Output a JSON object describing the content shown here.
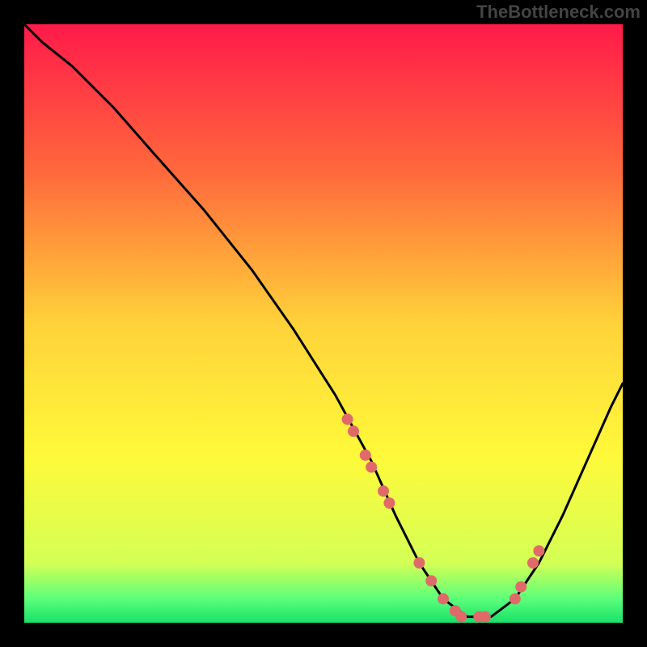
{
  "watermark": "TheBottleneck.com",
  "colors": {
    "curve": "#000000",
    "marker_fill": "#e06a6a",
    "marker_stroke": "#aa4040",
    "gradient_stops": [
      "#ff1a4a",
      "#ff6a3c",
      "#ffd23a",
      "#fff93a",
      "#d4ff55",
      "#5cff7a",
      "#18e06a"
    ]
  },
  "chart_data": {
    "type": "line",
    "title": "",
    "xlabel": "",
    "ylabel": "",
    "xlim": [
      0,
      100
    ],
    "ylim": [
      0,
      100
    ],
    "curve": {
      "x": [
        0,
        3,
        8,
        15,
        22,
        30,
        38,
        45,
        52,
        58,
        62,
        66,
        70,
        74,
        78,
        82,
        86,
        90,
        94,
        98,
        100
      ],
      "y": [
        100,
        97,
        93,
        86,
        78,
        69,
        59,
        49,
        38,
        27,
        18,
        10,
        4,
        1,
        1,
        4,
        10,
        18,
        27,
        36,
        40
      ]
    },
    "markers": {
      "comment": "scatter points lying on the curve",
      "x": [
        54,
        55,
        57,
        58,
        60,
        61,
        66,
        68,
        70,
        72,
        73,
        76,
        77,
        82,
        83,
        85,
        86
      ],
      "y": [
        34,
        32,
        28,
        26,
        22,
        20,
        10,
        7,
        4,
        2,
        1,
        1,
        1,
        4,
        6,
        10,
        12
      ]
    }
  }
}
